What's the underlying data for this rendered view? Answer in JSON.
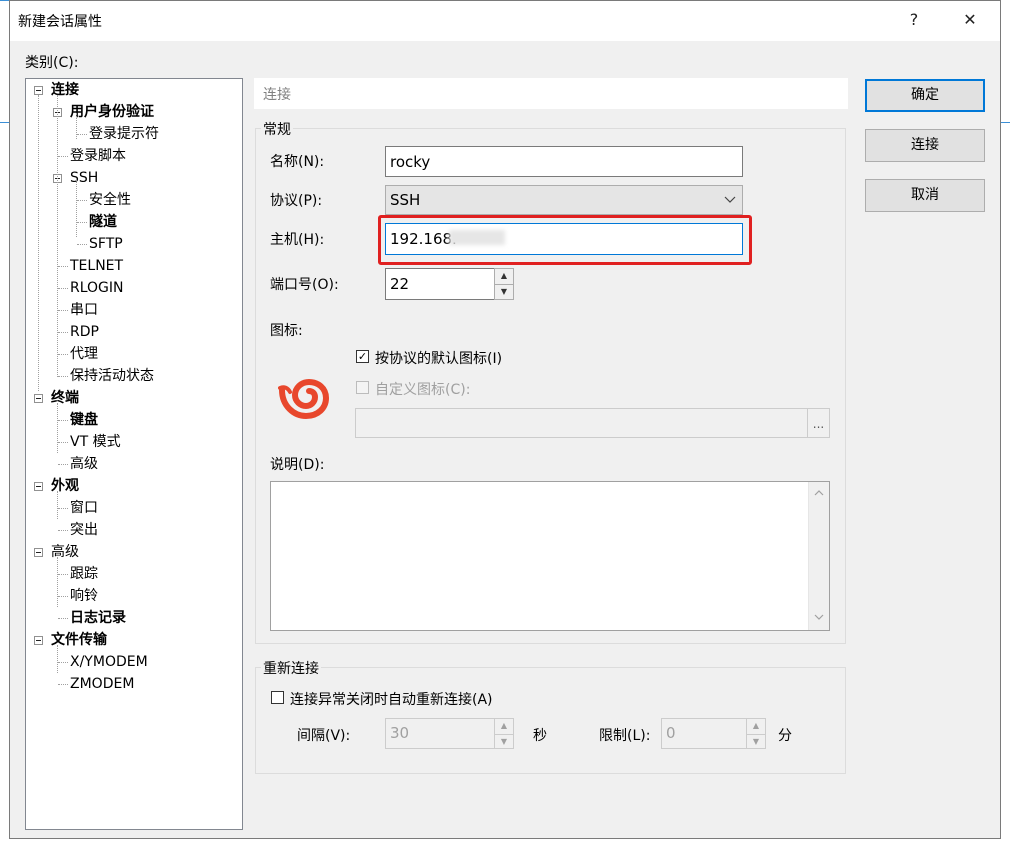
{
  "window": {
    "title": "新建会话属性",
    "help_label": "?",
    "close_label": "✕"
  },
  "category_label": "类别(C):",
  "tree": [
    {
      "label": "连接",
      "bold": true,
      "expanded": true
    },
    {
      "label": "用户身份验证",
      "bold": true,
      "expanded": true
    },
    {
      "label": "登录提示符",
      "bold": false
    },
    {
      "label": "登录脚本",
      "bold": false
    },
    {
      "label": "SSH",
      "bold": false,
      "expanded": true
    },
    {
      "label": "安全性",
      "bold": false
    },
    {
      "label": "隧道",
      "bold": true
    },
    {
      "label": "SFTP",
      "bold": false
    },
    {
      "label": "TELNET",
      "bold": false
    },
    {
      "label": "RLOGIN",
      "bold": false
    },
    {
      "label": "串口",
      "bold": false
    },
    {
      "label": "RDP",
      "bold": false
    },
    {
      "label": "代理",
      "bold": false
    },
    {
      "label": "保持活动状态",
      "bold": false
    },
    {
      "label": "终端",
      "bold": true,
      "expanded": true
    },
    {
      "label": "键盘",
      "bold": true
    },
    {
      "label": "VT 模式",
      "bold": false
    },
    {
      "label": "高级",
      "bold": false
    },
    {
      "label": "外观",
      "bold": true,
      "expanded": true
    },
    {
      "label": "窗口",
      "bold": false
    },
    {
      "label": "突出",
      "bold": false
    },
    {
      "label": "高级",
      "bold": false,
      "expanded": true
    },
    {
      "label": "跟踪",
      "bold": false
    },
    {
      "label": "响铃",
      "bold": false
    },
    {
      "label": "日志记录",
      "bold": true
    },
    {
      "label": "文件传输",
      "bold": true,
      "expanded": true
    },
    {
      "label": "X/YMODEM",
      "bold": false
    },
    {
      "label": "ZMODEM",
      "bold": false
    }
  ],
  "panel_header": "连接",
  "general": {
    "group_label": "常规",
    "name_label": "名称(N):",
    "name_value": "rocky",
    "protocol_label": "协议(P):",
    "protocol_value": "SSH",
    "host_label": "主机(H):",
    "host_value": "192.168.",
    "port_label": "端口号(O):",
    "port_value": "22",
    "icon_label": "图标:",
    "default_icon_checkbox": "按协议的默认图标(I)",
    "default_icon_checked": true,
    "custom_icon_checkbox": "自定义图标(C):",
    "browse_label": "...",
    "description_label": "说明(D):"
  },
  "reconnect": {
    "group_label": "重新连接",
    "auto_reconnect_label": "连接异常关闭时自动重新连接(A)",
    "interval_label": "间隔(V):",
    "interval_value": "30",
    "interval_unit": "秒",
    "limit_label": "限制(L):",
    "limit_value": "0",
    "limit_unit": "分"
  },
  "buttons": {
    "ok": "确定",
    "connect": "连接",
    "cancel": "取消"
  },
  "colors": {
    "highlight": "#e02020",
    "default_button_border": "#0078d7",
    "icon_red": "#e8472c"
  }
}
